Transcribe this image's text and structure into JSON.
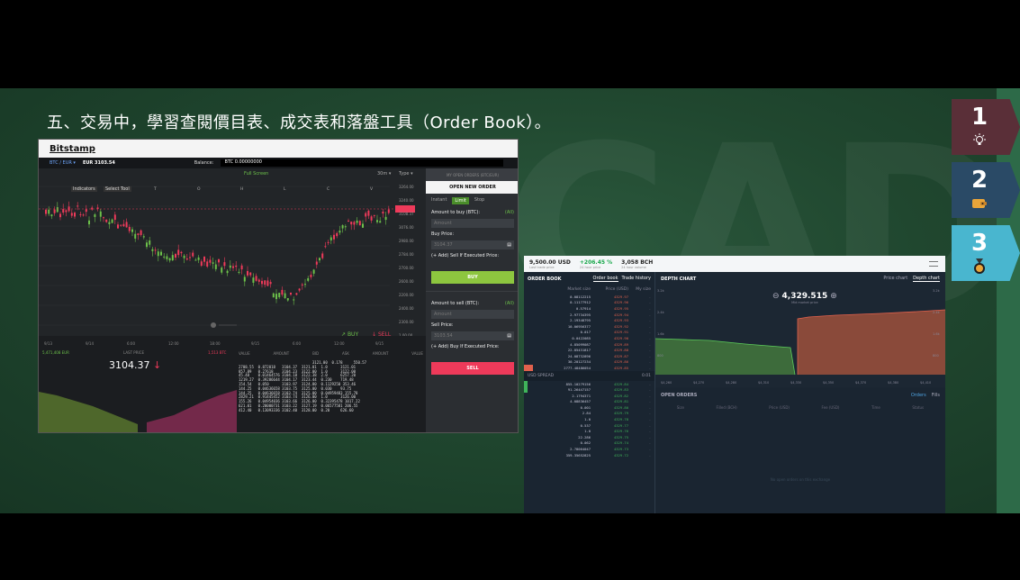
{
  "slide": {
    "title": "五、交易中，學習查閱價目表、成交表和落盤工具（Order Book）。",
    "bg_letters": "CAD",
    "steps": [
      {
        "num": "1",
        "icon": "lightbulb-icon",
        "color": "#5a2f38"
      },
      {
        "num": "2",
        "icon": "wallet-icon",
        "color": "#2a4a66"
      },
      {
        "num": "3",
        "icon": "medal-icon",
        "color": "#49b6cf"
      }
    ]
  },
  "bitstamp": {
    "logo": "Bitstamp",
    "pair": "BTC / EUR ▾",
    "pair_price": "EUR 3103.54",
    "balance_label": "Balance:",
    "balance_value": "BTC 0.00000000",
    "chart_toolbar": {
      "indicators": "Indicators",
      "select_tool": "Select Tool",
      "fullscreen": "Full Screen",
      "interval": "30m ▾",
      "type": "Type ▾",
      "col_letters": [
        "T",
        "O",
        "H",
        "L",
        "C",
        "V"
      ]
    },
    "y_ticks": [
      "3264.00",
      "3240.00",
      "3108.37",
      "3076.00",
      "2980.00",
      "2784.00",
      "2700.00",
      "2600.00",
      "2200.00",
      "2400.00",
      "2300.00",
      "1.00.00"
    ],
    "x_ticks": [
      "9/13",
      "9/14",
      "6:00",
      "12:00",
      "18:00",
      "9/15",
      "6:00",
      "12:00",
      "9/15"
    ],
    "buy_label": "BUY",
    "sell_label": "SELL",
    "bottom": {
      "left_stat": "5,471,408 EUR",
      "last_price_label": "LAST PRICE",
      "last_price": "3104.37",
      "last_price_arrow": "↓",
      "right_stat": "1,513 BTC",
      "cols": [
        "VALUE",
        "AMOUNT",
        "BID",
        "ASK",
        "AMOUNT",
        "VALUE"
      ],
      "trade_rows": [
        "                                  3121.00  0.178     550.57",
        "2708.55  0.872018   3104.37  3121.01  1.0      3121.01",
        "857.89   0.27618    3104.23  3122.00  1.0      3122.00",
        "45.48    0.01464576 3104.18  3122.38  2.0      6257.20",
        "1219.27  0.39286644 3104.17  3123.44  0.230    719.48",
        "154.54   0.050      3103.97  3124.80  0.1129250 353.46",
        "144.25   0.04636658 3103.75  3125.00  0.030    93.75",
        "144.25   0.04636658 3103.74  3125.00  0.04959483 155.78",
        "2829.21  0.91445452 3103.74  3126.00  1.0      3126.00",
        "155.26   0.04954036 3103.66  3126.00  0.32395478 1017.22",
        "621.01   0.20000731 3103.22  3127.19  0.06577581 206.55",
        "412.40   0.13093336 3102.40  3128.00  0.20     626.60"
      ]
    },
    "order_panel": {
      "my_orders": "MY OPEN ORDERS (BTC/EUR)",
      "header": "OPEN NEW ORDER",
      "tabs": [
        "Instant",
        "Limit",
        "Stop"
      ],
      "active_tab": "Limit",
      "amount_buy": "Amount to buy (BTC):",
      "all": "(All)",
      "amount_placeholder": "Amount",
      "buy_price": "Buy Price:",
      "buy_price_value": "3104.37",
      "sell_if_executed": "(+ Add) Sell If Executed Price:",
      "buy_button": "BUY",
      "amount_sell": "Amount to sell (BTC):",
      "sell_price": "Sell Price:",
      "sell_price_value": "3103.54",
      "buy_if_executed": "(+ Add) Buy If Executed Price:",
      "sell_button": "SELL"
    }
  },
  "exchange": {
    "price": "9,500.00 USD",
    "price_sub": "Last trade price",
    "change": "+206.45 %",
    "change_sub": "24 hour price",
    "volume": "3,058 BCH",
    "volume_sub": "24 hour volume",
    "orderbook": {
      "title": "ORDER BOOK",
      "tabs": [
        "Order book",
        "Trade history"
      ],
      "cols": [
        "Market size",
        "Price (USD)",
        "My size"
      ],
      "asks": [
        [
          "0.08112215",
          "4329.97"
        ],
        [
          "0.11177912",
          "4329.96"
        ],
        [
          "0.57914",
          "4329.95"
        ],
        [
          "2.97734395",
          "4329.94"
        ],
        [
          "2.19348795",
          "4329.93"
        ],
        [
          "10.06956377",
          "4329.92"
        ],
        [
          "0.017",
          "4329.91"
        ],
        [
          "0.0422085",
          "4329.90"
        ],
        [
          "4.85099087",
          "4329.89"
        ],
        [
          "22.85431817",
          "4329.88"
        ],
        [
          "24.08732896",
          "4329.87"
        ],
        [
          "30.20127234",
          "4329.86"
        ],
        [
          "2777.48486054",
          "4329.85"
        ]
      ],
      "spread_label": "USD SPREAD",
      "spread_value": "0.01",
      "bids": [
        [
          "855.10279156",
          "4329.84"
        ],
        [
          "91.26447157",
          "4329.83"
        ],
        [
          "2.1794371",
          "4329.82"
        ],
        [
          "4.08836457",
          "4329.81"
        ],
        [
          "0.001",
          "4329.80"
        ],
        [
          "2.84",
          "4329.79"
        ],
        [
          "1.0",
          "4329.78"
        ],
        [
          "0.537",
          "4329.77"
        ],
        [
          "1.0",
          "4329.76"
        ],
        [
          "22.286",
          "4329.75"
        ],
        [
          "0.062",
          "4329.74"
        ],
        [
          "2.78064047",
          "4329.73"
        ],
        [
          "359.35652825",
          "4329.72"
        ]
      ],
      "my_size": "-"
    },
    "depth": {
      "title": "DEPTH CHART",
      "tabs": [
        "Price chart",
        "Depth chart"
      ],
      "mid_value": "4,329.515",
      "mid_sub": "Mid market price",
      "x_ticks": [
        "$4,260",
        "$4,270",
        "$4,280",
        "$4,310",
        "$4,330",
        "$4,350",
        "$4,370",
        "$4,380",
        "$4,410"
      ],
      "y_ticks_left": [
        "3.2k",
        "2.4k",
        "1.6k",
        "800"
      ],
      "y_ticks_right": [
        "3.2k",
        "2.4k",
        "1.6k",
        "800"
      ]
    },
    "open_orders": {
      "title": "OPEN ORDERS",
      "tabs": [
        "Orders",
        "Fills"
      ],
      "active_tab": "Orders",
      "cols": [
        "Size",
        "Filled (BCH)",
        "Price (USD)",
        "Fee (USD)",
        "Time",
        "Status"
      ],
      "empty": "No open orders on this exchange"
    }
  }
}
